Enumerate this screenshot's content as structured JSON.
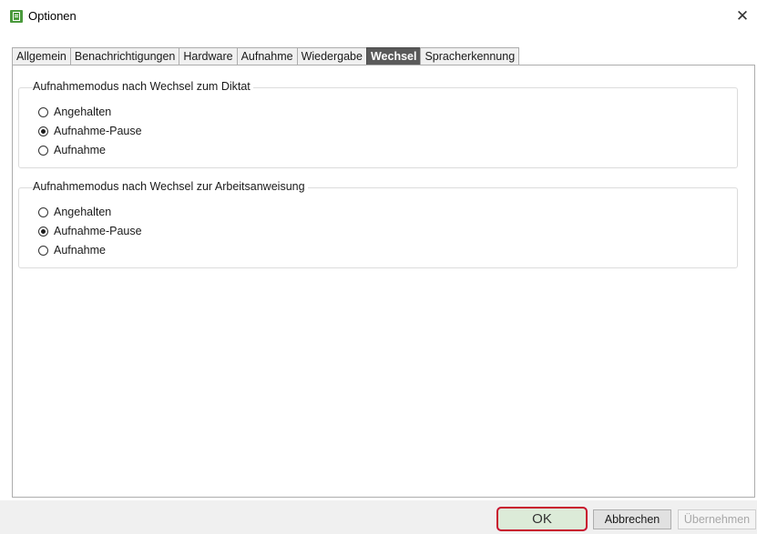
{
  "window": {
    "title": "Optionen",
    "close_symbol": "✕",
    "icon": "app-note-icon",
    "accent_color": "#4a9a3c"
  },
  "tabs": [
    {
      "label": "Allgemein",
      "active": false
    },
    {
      "label": "Benachrichtigungen",
      "active": false
    },
    {
      "label": "Hardware",
      "active": false
    },
    {
      "label": "Aufnahme",
      "active": false
    },
    {
      "label": "Wiedergabe",
      "active": false
    },
    {
      "label": "Wechsel",
      "active": true
    },
    {
      "label": "Spracherkennung",
      "active": false
    }
  ],
  "groups": [
    {
      "legend": "Aufnahmemodus nach Wechsel zum Diktat",
      "options": [
        {
          "label": "Angehalten",
          "checked": false
        },
        {
          "label": "Aufnahme-Pause",
          "checked": true
        },
        {
          "label": "Aufnahme",
          "checked": false
        }
      ]
    },
    {
      "legend": "Aufnahmemodus nach Wechsel zur Arbeitsanweisung",
      "options": [
        {
          "label": "Angehalten",
          "checked": false
        },
        {
          "label": "Aufnahme-Pause",
          "checked": true
        },
        {
          "label": "Aufnahme",
          "checked": false
        }
      ]
    }
  ],
  "buttons": {
    "ok": "OK",
    "cancel": "Abbrechen",
    "apply": "Übernehmen"
  }
}
